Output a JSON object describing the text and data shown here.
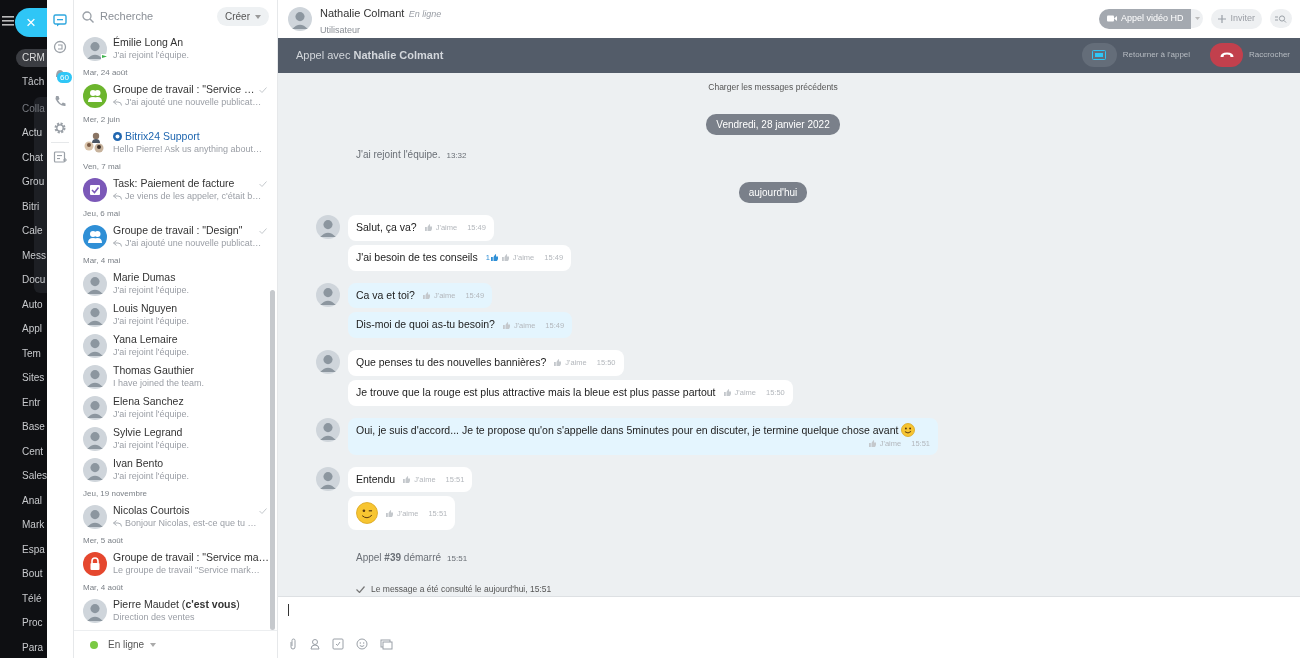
{
  "left_menu": [
    {
      "kind": "tag",
      "label": "CRM"
    },
    {
      "kind": "link",
      "label": "Tâch"
    },
    {
      "kind": "group",
      "title": "Colla",
      "children": [
        {
          "label": "Actu"
        },
        {
          "label": "Chat"
        },
        {
          "label": "Grou"
        },
        {
          "label": "Bitri"
        },
        {
          "label": "Cale"
        },
        {
          "label": "Mess"
        },
        {
          "label": "Docu"
        }
      ]
    },
    {
      "kind": "link",
      "label": "Auto"
    },
    {
      "kind": "link",
      "label": "Appl"
    },
    {
      "kind": "link",
      "label": "Tem"
    },
    {
      "kind": "link",
      "label": "Sites"
    },
    {
      "kind": "link",
      "label": "Entr"
    },
    {
      "kind": "link",
      "label": "Base"
    },
    {
      "kind": "link",
      "label": "Cent"
    },
    {
      "kind": "link",
      "label": "Sales"
    },
    {
      "kind": "link",
      "label": "Anal"
    },
    {
      "kind": "link",
      "label": "Mark"
    },
    {
      "kind": "link",
      "label": "Espa"
    },
    {
      "kind": "link",
      "label": "Bout"
    },
    {
      "kind": "link",
      "label": "Télé"
    },
    {
      "kind": "link",
      "label": "Proc"
    },
    {
      "kind": "link",
      "label": "Para"
    }
  ],
  "close_button": "×",
  "rail": [
    {
      "kind": "chat",
      "selected": true
    },
    {
      "kind": "openlines",
      "selected": false
    },
    {
      "kind": "notifications",
      "selected": false,
      "badge": "60"
    },
    {
      "kind": "phone",
      "selected": false
    },
    {
      "kind": "settings",
      "selected": false
    },
    {
      "kind": "notes",
      "selected": false
    }
  ],
  "chat_list": {
    "search": {
      "placeholder": "Recherche"
    },
    "create_button": "Créer",
    "items": [
      {
        "kind": "chat",
        "avatar": {
          "kind": "photo"
        },
        "avatar_badge": true,
        "name": "Émilie Long An",
        "preview": "J'ai rejoint l'équipe."
      },
      {
        "kind": "date",
        "label": "Mar, 24 août"
      },
      {
        "kind": "chat",
        "avatar": {
          "kind": "group",
          "color": "#6cb52d"
        },
        "name": "Groupe de travail : \"Service …",
        "preview": "J'ai ajouté une nouvelle publicat…",
        "replied": true,
        "read": true
      },
      {
        "kind": "date",
        "label": "Mer, 2 juin"
      },
      {
        "kind": "chat",
        "avatar": {
          "kind": "people"
        },
        "name": "Bitrix24 Support",
        "link": true,
        "preview": "Hello Pierre! Ask us anything about…"
      },
      {
        "kind": "date",
        "label": "Ven, 7 mai"
      },
      {
        "kind": "chat",
        "avatar": {
          "kind": "task",
          "color": "#7b58b8"
        },
        "name": "Task: Paiement de facture",
        "preview": "Je viens de les appeler, c'était b…",
        "replied": true,
        "read": true
      },
      {
        "kind": "date",
        "label": "Jeu, 6 mai"
      },
      {
        "kind": "chat",
        "avatar": {
          "kind": "group",
          "color": "#2f8fd6"
        },
        "name": "Groupe de travail : \"Design\"",
        "preview": "J'ai ajouté une nouvelle publicat…",
        "replied": true,
        "read": true
      },
      {
        "kind": "date",
        "label": "Mar, 4 mai"
      },
      {
        "kind": "chat",
        "avatar": {
          "kind": "photo"
        },
        "name": "Marie Dumas",
        "preview": "J'ai rejoint l'équipe."
      },
      {
        "kind": "chat",
        "avatar": {
          "kind": "photo"
        },
        "name": "Louis Nguyen",
        "preview": "J'ai rejoint l'équipe."
      },
      {
        "kind": "chat",
        "avatar": {
          "kind": "photo"
        },
        "name": "Yana Lemaire",
        "preview": "J'ai rejoint l'équipe."
      },
      {
        "kind": "chat",
        "avatar": {
          "kind": "photo"
        },
        "name": "Thomas Gauthier",
        "preview": "I have joined the team."
      },
      {
        "kind": "chat",
        "avatar": {
          "kind": "photo"
        },
        "name": "Elena Sanchez",
        "preview": "J'ai rejoint l'équipe."
      },
      {
        "kind": "chat",
        "avatar": {
          "kind": "photo"
        },
        "name": "Sylvie Legrand",
        "preview": "J'ai rejoint l'équipe."
      },
      {
        "kind": "chat",
        "avatar": {
          "kind": "photo"
        },
        "name": "Ivan Bento",
        "preview": "J'ai rejoint l'équipe."
      },
      {
        "kind": "date",
        "label": "Jeu, 19 novembre"
      },
      {
        "kind": "chat",
        "avatar": {
          "kind": "photo"
        },
        "name": "Nicolas Courtois",
        "preview": "Bonjour Nicolas, est-ce que tu …",
        "replied": true,
        "read": true
      },
      {
        "kind": "date",
        "label": "Mer, 5 août"
      },
      {
        "kind": "chat",
        "avatar": {
          "kind": "lock",
          "color": "#e5472e"
        },
        "name": "Groupe de travail : \"Service ma…",
        "preview": "Le groupe de travail \"Service mark…"
      },
      {
        "kind": "date",
        "label": "Mar, 4 août"
      },
      {
        "kind": "chat",
        "avatar": {
          "kind": "photo"
        },
        "name": "Pierre Maudet (**c'est vous**)",
        "preview": "Direction des ventes"
      }
    ],
    "status": {
      "label": "En ligne",
      "color": "#7ac943"
    }
  },
  "header": {
    "name": "Nathalie Colmant",
    "status": "En ligne",
    "role": "Utilisateur",
    "video_button": "Appel vidéo HD",
    "invite_button": "Inviter"
  },
  "call_bar": {
    "title": "Appel avec **Nathalie Colmant**",
    "return_button": "Retourner à l'appel",
    "hangup_button": "Raccrocher"
  },
  "messages": [
    {
      "kind": "load",
      "text": "Charger les messages précédents"
    },
    {
      "kind": "date",
      "text": "Vendredi, 28 janvier 2022"
    },
    {
      "kind": "system",
      "text": "J'ai rejoint l'équipe.",
      "time": "13:32"
    },
    {
      "kind": "date",
      "text": "aujourd'hui"
    },
    {
      "kind": "group",
      "mine": false,
      "bubbles": [
        {
          "kind": "text",
          "text": "Salut, ça va?",
          "like": "J'aime",
          "time": "15:49"
        },
        {
          "kind": "text",
          "text": "J'ai besoin de tes conseils",
          "likes": "1",
          "like": "J'aime",
          "time": "15:49"
        }
      ]
    },
    {
      "kind": "group",
      "mine": true,
      "bubbles": [
        {
          "kind": "text",
          "text": "Ca va et toi?",
          "like": "J'aime",
          "time": "15:49"
        },
        {
          "kind": "text",
          "text": "Dis-moi de quoi as-tu besoin?",
          "like": "J'aime",
          "time": "15:49"
        }
      ]
    },
    {
      "kind": "group",
      "mine": false,
      "bubbles": [
        {
          "kind": "text",
          "text": "Que penses tu des nouvelles bannières?",
          "like": "J'aime",
          "time": "15:50"
        },
        {
          "kind": "text",
          "text": "Je trouve que la rouge est plus attractive mais la bleue est plus passe partout",
          "like": "J'aime",
          "time": "15:50"
        }
      ]
    },
    {
      "kind": "group",
      "mine": true,
      "bubbles": [
        {
          "kind": "text",
          "text": "Oui, je suis d'accord... Je te propose qu'on s'appelle dans 5minutes pour en discuter, je termine quelque chose avant",
          "emoji": true,
          "like": "J'aime",
          "time": "15:51"
        }
      ]
    },
    {
      "kind": "group",
      "mine": false,
      "bubbles": [
        {
          "kind": "text",
          "text": "Entendu",
          "like": "J'aime",
          "time": "15:51"
        },
        {
          "kind": "sticker",
          "like": "J'aime",
          "time": "15:51"
        }
      ]
    },
    {
      "kind": "system",
      "text": "Appel **#39** démarré",
      "time": "15:51"
    },
    {
      "kind": "receipt",
      "text": "Le message a été consulté le aujourd'hui, 15:51"
    }
  ]
}
